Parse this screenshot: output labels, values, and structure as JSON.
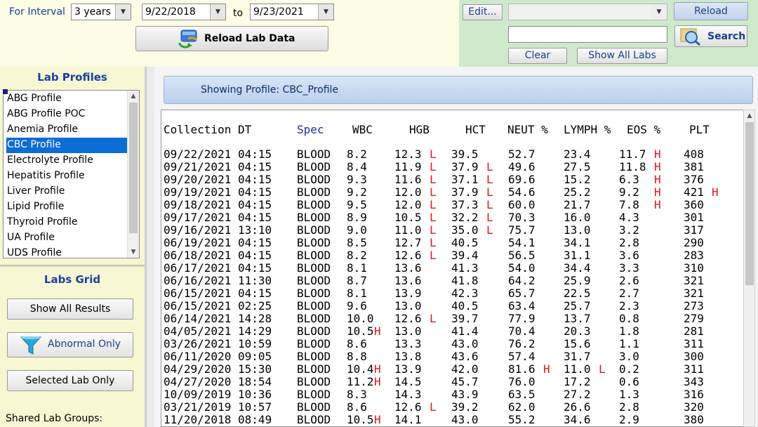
{
  "filter": {
    "interval_label": "For Interval",
    "interval_value": "3 years",
    "from_date": "9/22/2018",
    "to_label": "to",
    "to_date": "9/23/2021",
    "reload_lab_data_label": "Reload Lab Data"
  },
  "toolbar": {
    "edit_label": "Edit...",
    "profile_value": "",
    "reload_label": "Reload",
    "search_value": "",
    "search_label": "Search",
    "clear_label": "Clear",
    "show_all_labs_label": "Show All Labs"
  },
  "sidebar": {
    "lab_profiles_title": "Lab Profiles",
    "profiles": [
      "ABG Profile",
      "ABG Profile POC",
      "Anemia Profile",
      "CBC Profile",
      "Electrolyte Profile",
      "Hepatitis Profile",
      "Liver Profile",
      "Lipid Profile",
      "Thyroid Profile",
      "UA Profile",
      "UDS Profile"
    ],
    "selected_profile": "CBC Profile",
    "labs_grid_title": "Labs Grid",
    "show_all_results_label": "Show All Results",
    "abnormal_only_label": "Abnormal Only",
    "selected_lab_only_label": "Selected Lab Only",
    "shared_lab_groups_label": "Shared Lab Groups:"
  },
  "main": {
    "showing_profile": "Showing Profile: CBC_Profile",
    "headers": {
      "collection": "Collection DT",
      "spec": "Spec",
      "wbc": "WBC",
      "hgb": "HGB",
      "hct": "HCT",
      "neut": "NEUT %",
      "lymph": "LYMPH %",
      "eos": "EOS %",
      "plt": "PLT"
    },
    "rows": [
      {
        "dt": "09/22/2021 04:15",
        "spec": "BLOOD",
        "wbc": "8.2",
        "wbc_f": "",
        "hgb": "12.3",
        "hgb_f": "L",
        "hct": "39.5",
        "hct_f": "",
        "neut": "52.7",
        "neut_f": "",
        "lymph": "23.4",
        "lymph_f": "",
        "eos": "11.7",
        "eos_f": "H",
        "plt": "408",
        "plt_f": ""
      },
      {
        "dt": "09/21/2021 04:15",
        "spec": "BLOOD",
        "wbc": "8.4",
        "wbc_f": "",
        "hgb": "11.9",
        "hgb_f": "L",
        "hct": "37.9",
        "hct_f": "L",
        "neut": "49.6",
        "neut_f": "",
        "lymph": "27.5",
        "lymph_f": "",
        "eos": "11.8",
        "eos_f": "H",
        "plt": "381",
        "plt_f": ""
      },
      {
        "dt": "09/20/2021 04:15",
        "spec": "BLOOD",
        "wbc": "9.3",
        "wbc_f": "",
        "hgb": "11.6",
        "hgb_f": "L",
        "hct": "37.1",
        "hct_f": "L",
        "neut": "69.6",
        "neut_f": "",
        "lymph": "15.2",
        "lymph_f": "",
        "eos": "6.3",
        "eos_f": "H",
        "plt": "376",
        "plt_f": ""
      },
      {
        "dt": "09/19/2021 04:15",
        "spec": "BLOOD",
        "wbc": "9.2",
        "wbc_f": "",
        "hgb": "12.0",
        "hgb_f": "L",
        "hct": "37.9",
        "hct_f": "L",
        "neut": "54.6",
        "neut_f": "",
        "lymph": "25.2",
        "lymph_f": "",
        "eos": "9.2",
        "eos_f": "H",
        "plt": "421",
        "plt_f": "H"
      },
      {
        "dt": "09/18/2021 04:15",
        "spec": "BLOOD",
        "wbc": "9.5",
        "wbc_f": "",
        "hgb": "12.0",
        "hgb_f": "L",
        "hct": "37.3",
        "hct_f": "L",
        "neut": "60.0",
        "neut_f": "",
        "lymph": "21.7",
        "lymph_f": "",
        "eos": "7.8",
        "eos_f": "H",
        "plt": "360",
        "plt_f": ""
      },
      {
        "dt": "09/17/2021 04:15",
        "spec": "BLOOD",
        "wbc": "8.9",
        "wbc_f": "",
        "hgb": "10.5",
        "hgb_f": "L",
        "hct": "32.2",
        "hct_f": "L",
        "neut": "70.3",
        "neut_f": "",
        "lymph": "16.0",
        "lymph_f": "",
        "eos": "4.3",
        "eos_f": "",
        "plt": "301",
        "plt_f": ""
      },
      {
        "dt": "09/16/2021 13:10",
        "spec": "BLOOD",
        "wbc": "9.0",
        "wbc_f": "",
        "hgb": "11.0",
        "hgb_f": "L",
        "hct": "35.0",
        "hct_f": "L",
        "neut": "75.7",
        "neut_f": "",
        "lymph": "13.0",
        "lymph_f": "",
        "eos": "3.2",
        "eos_f": "",
        "plt": "317",
        "plt_f": ""
      },
      {
        "dt": "06/19/2021 04:15",
        "spec": "BLOOD",
        "wbc": "8.5",
        "wbc_f": "",
        "hgb": "12.7",
        "hgb_f": "L",
        "hct": "40.5",
        "hct_f": "",
        "neut": "54.1",
        "neut_f": "",
        "lymph": "34.1",
        "lymph_f": "",
        "eos": "2.8",
        "eos_f": "",
        "plt": "290",
        "plt_f": ""
      },
      {
        "dt": "06/18/2021 04:15",
        "spec": "BLOOD",
        "wbc": "8.2",
        "wbc_f": "",
        "hgb": "12.6",
        "hgb_f": "L",
        "hct": "39.4",
        "hct_f": "",
        "neut": "56.5",
        "neut_f": "",
        "lymph": "31.1",
        "lymph_f": "",
        "eos": "3.6",
        "eos_f": "",
        "plt": "283",
        "plt_f": ""
      },
      {
        "dt": "06/17/2021 04:15",
        "spec": "BLOOD",
        "wbc": "8.1",
        "wbc_f": "",
        "hgb": "13.6",
        "hgb_f": "",
        "hct": "41.3",
        "hct_f": "",
        "neut": "54.0",
        "neut_f": "",
        "lymph": "34.4",
        "lymph_f": "",
        "eos": "3.3",
        "eos_f": "",
        "plt": "310",
        "plt_f": ""
      },
      {
        "dt": "06/16/2021 11:30",
        "spec": "BLOOD",
        "wbc": "8.7",
        "wbc_f": "",
        "hgb": "13.6",
        "hgb_f": "",
        "hct": "41.8",
        "hct_f": "",
        "neut": "64.2",
        "neut_f": "",
        "lymph": "25.9",
        "lymph_f": "",
        "eos": "2.6",
        "eos_f": "",
        "plt": "321",
        "plt_f": ""
      },
      {
        "dt": "06/15/2021 04:15",
        "spec": "BLOOD",
        "wbc": "8.1",
        "wbc_f": "",
        "hgb": "13.9",
        "hgb_f": "",
        "hct": "42.3",
        "hct_f": "",
        "neut": "65.7",
        "neut_f": "",
        "lymph": "22.5",
        "lymph_f": "",
        "eos": "2.7",
        "eos_f": "",
        "plt": "321",
        "plt_f": ""
      },
      {
        "dt": "06/15/2021 02:25",
        "spec": "BLOOD",
        "wbc": "9.6",
        "wbc_f": "",
        "hgb": "13.0",
        "hgb_f": "",
        "hct": "40.5",
        "hct_f": "",
        "neut": "63.4",
        "neut_f": "",
        "lymph": "25.7",
        "lymph_f": "",
        "eos": "2.3",
        "eos_f": "",
        "plt": "273",
        "plt_f": ""
      },
      {
        "dt": "06/14/2021 14:28",
        "spec": "BLOOD",
        "wbc": "10.0",
        "wbc_f": "",
        "hgb": "12.6",
        "hgb_f": "L",
        "hct": "39.7",
        "hct_f": "",
        "neut": "77.9",
        "neut_f": "",
        "lymph": "13.7",
        "lymph_f": "",
        "eos": "0.8",
        "eos_f": "",
        "plt": "279",
        "plt_f": ""
      },
      {
        "dt": "04/05/2021 14:29",
        "spec": "BLOOD",
        "wbc": "10.5",
        "wbc_f": "H",
        "hgb": "13.0",
        "hgb_f": "",
        "hct": "41.4",
        "hct_f": "",
        "neut": "70.4",
        "neut_f": "",
        "lymph": "20.3",
        "lymph_f": "",
        "eos": "1.8",
        "eos_f": "",
        "plt": "281",
        "plt_f": ""
      },
      {
        "dt": "03/26/2021 10:59",
        "spec": "BLOOD",
        "wbc": "8.6",
        "wbc_f": "",
        "hgb": "13.3",
        "hgb_f": "",
        "hct": "43.0",
        "hct_f": "",
        "neut": "76.2",
        "neut_f": "",
        "lymph": "15.6",
        "lymph_f": "",
        "eos": "1.1",
        "eos_f": "",
        "plt": "311",
        "plt_f": ""
      },
      {
        "dt": "06/11/2020 09:05",
        "spec": "BLOOD",
        "wbc": "8.8",
        "wbc_f": "",
        "hgb": "13.8",
        "hgb_f": "",
        "hct": "43.6",
        "hct_f": "",
        "neut": "57.4",
        "neut_f": "",
        "lymph": "31.7",
        "lymph_f": "",
        "eos": "3.0",
        "eos_f": "",
        "plt": "300",
        "plt_f": ""
      },
      {
        "dt": "04/29/2020 15:30",
        "spec": "BLOOD",
        "wbc": "10.4",
        "wbc_f": "H",
        "hgb": "13.9",
        "hgb_f": "",
        "hct": "42.0",
        "hct_f": "",
        "neut": "81.6",
        "neut_f": "H",
        "lymph": "11.0",
        "lymph_f": "L",
        "eos": "0.2",
        "eos_f": "",
        "plt": "311",
        "plt_f": ""
      },
      {
        "dt": "04/27/2020 18:54",
        "spec": "BLOOD",
        "wbc": "11.2",
        "wbc_f": "H",
        "hgb": "14.5",
        "hgb_f": "",
        "hct": "45.7",
        "hct_f": "",
        "neut": "76.0",
        "neut_f": "",
        "lymph": "17.2",
        "lymph_f": "",
        "eos": "0.6",
        "eos_f": "",
        "plt": "343",
        "plt_f": ""
      },
      {
        "dt": "10/09/2019 10:36",
        "spec": "BLOOD",
        "wbc": "8.3",
        "wbc_f": "",
        "hgb": "14.3",
        "hgb_f": "",
        "hct": "43.9",
        "hct_f": "",
        "neut": "63.5",
        "neut_f": "",
        "lymph": "27.2",
        "lymph_f": "",
        "eos": "1.3",
        "eos_f": "",
        "plt": "316",
        "plt_f": ""
      },
      {
        "dt": "03/21/2019 10:57",
        "spec": "BLOOD",
        "wbc": "8.6",
        "wbc_f": "",
        "hgb": "12.6",
        "hgb_f": "L",
        "hct": "39.2",
        "hct_f": "",
        "neut": "62.0",
        "neut_f": "",
        "lymph": "26.6",
        "lymph_f": "",
        "eos": "2.8",
        "eos_f": "",
        "plt": "320",
        "plt_f": ""
      },
      {
        "dt": "11/20/2018 08:49",
        "spec": "BLOOD",
        "wbc": "10.5",
        "wbc_f": "H",
        "hgb": "14.1",
        "hgb_f": "",
        "hct": "43.0",
        "hct_f": "",
        "neut": "55.2",
        "neut_f": "",
        "lymph": "34.6",
        "lymph_f": "",
        "eos": "2.9",
        "eos_f": "",
        "plt": "380",
        "plt_f": ""
      }
    ]
  }
}
